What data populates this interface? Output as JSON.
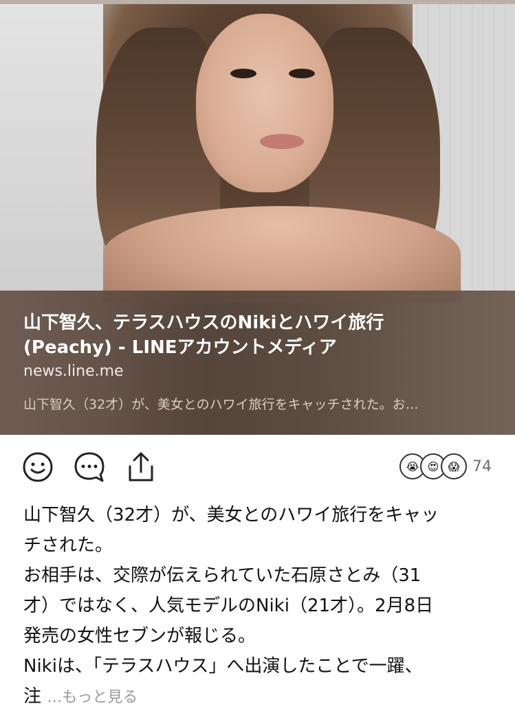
{
  "card": {
    "title_line1": "山下智久、テラスハウスのNikiとハワイ旅行",
    "title_line2": "(Peachy) - LINEアカウントメディア",
    "domain": "news.line.me",
    "snippet": "山下智久（32才）が、美女とのハワイ旅行をキャッチされた。お…"
  },
  "actions": {
    "react_icon": "smiley-icon",
    "comment_icon": "comment-icon",
    "share_icon": "share-icon"
  },
  "reactions": {
    "icons": [
      "crying-face-icon",
      "heart-eyes-icon",
      "shocked-face-icon"
    ],
    "count": "74"
  },
  "post": {
    "lines": [
      "山下智久（32才）が、美女とのハワイ旅行をキャッ",
      "チされた。",
      "お相手は、交際が伝えられていた石原さとみ（31",
      "才）ではなく、人気モデルのNiki（21才）。2月8日",
      "発売の女性セブンが報じる。",
      "Nikiは、「テラスハウス」へ出演したことで一躍、"
    ],
    "last_fragment": "注",
    "more_label": "…もっと見る"
  }
}
